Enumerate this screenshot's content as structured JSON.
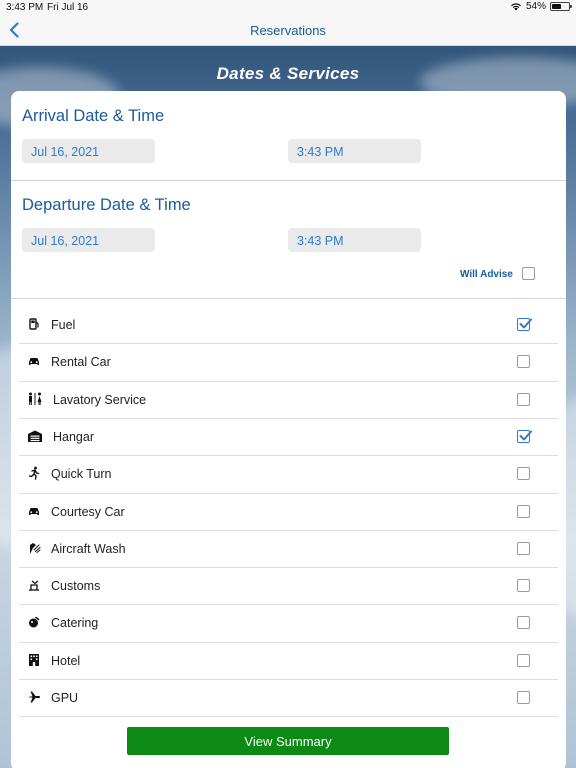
{
  "status_bar": {
    "time": "3:43 PM",
    "date": "Fri Jul 16",
    "battery": "54%",
    "battery_level": 0.54
  },
  "nav": {
    "title": "Reservations",
    "back_icon": "chevron-left-icon"
  },
  "header": {
    "title": "Dates & Services"
  },
  "arrival": {
    "title": "Arrival Date & Time",
    "date": "Jul 16, 2021",
    "time": "3:43 PM"
  },
  "departure": {
    "title": "Departure Date & Time",
    "date": "Jul 16, 2021",
    "time": "3:43 PM"
  },
  "will_advise": {
    "label": "Will Advise",
    "checked": false
  },
  "services": [
    {
      "label": "Fuel",
      "icon": "fuel-pump-icon",
      "checked": true
    },
    {
      "label": "Rental Car",
      "icon": "car-icon",
      "checked": false
    },
    {
      "label": "Lavatory Service",
      "icon": "restroom-icon",
      "checked": false
    },
    {
      "label": "Hangar",
      "icon": "warehouse-icon",
      "checked": true
    },
    {
      "label": "Quick Turn",
      "icon": "running-icon",
      "checked": false
    },
    {
      "label": "Courtesy Car",
      "icon": "car-icon",
      "checked": false
    },
    {
      "label": "Aircraft Wash",
      "icon": "spray-icon",
      "checked": false
    },
    {
      "label": "Customs",
      "icon": "customs-icon",
      "checked": false
    },
    {
      "label": "Catering",
      "icon": "food-icon",
      "checked": false
    },
    {
      "label": "Hotel",
      "icon": "hotel-icon",
      "checked": false
    },
    {
      "label": "GPU",
      "icon": "plane-icon",
      "checked": false
    }
  ],
  "summary_button": {
    "label": "View Summary"
  },
  "colors": {
    "accent": "#1a5b9a",
    "link": "#2d7bd0",
    "button": "#0d8a15"
  }
}
